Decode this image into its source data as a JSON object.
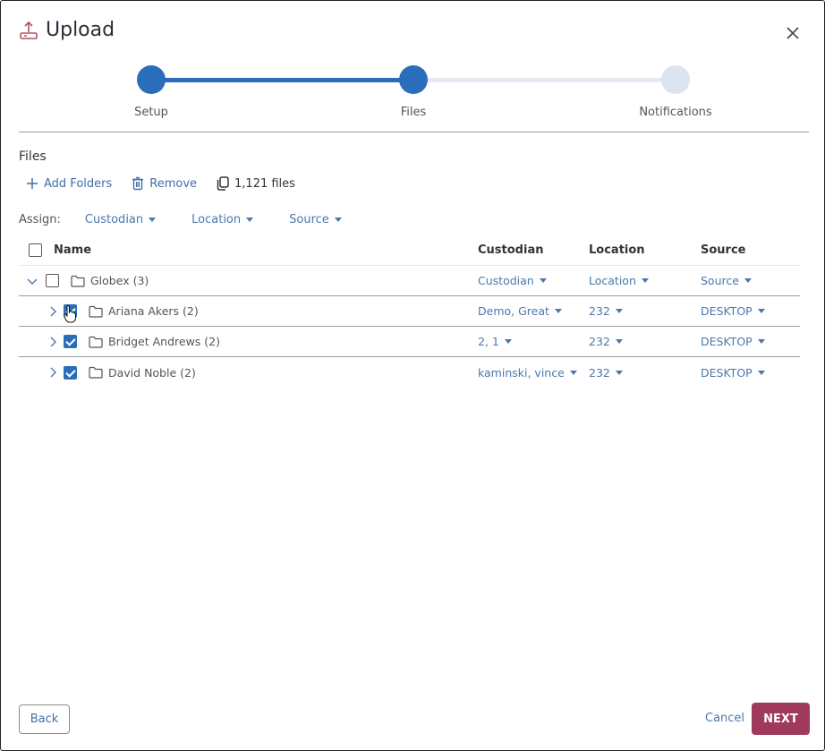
{
  "dialog": {
    "title": "Upload",
    "title_icon": "upload-icon",
    "close_icon": "close-icon"
  },
  "stepper": {
    "steps": [
      {
        "label": "Setup",
        "state": "complete"
      },
      {
        "label": "Files",
        "state": "current"
      },
      {
        "label": "Notifications",
        "state": "pending"
      }
    ]
  },
  "files": {
    "section_title": "Files",
    "toolbar": {
      "add_folders_label": "Add Folders",
      "remove_label": "Remove",
      "file_count": "1,121 files"
    },
    "assign": {
      "label": "Assign:",
      "custodian": "Custodian",
      "location": "Location",
      "source": "Source"
    },
    "table": {
      "headers": {
        "name": "Name",
        "custodian": "Custodian",
        "location": "Location",
        "source": "Source"
      },
      "rows": [
        {
          "name": "Globex (3)",
          "custodian": "Custodian",
          "location": "Location",
          "source": "Source",
          "checked": false,
          "expanded": true,
          "level": 0
        },
        {
          "name": "Ariana Akers (2)",
          "custodian": "Demo, Great",
          "location": "232",
          "source": "DESKTOP",
          "checked": true,
          "expanded": false,
          "level": 1
        },
        {
          "name": "Bridget Andrews (2)",
          "custodian": "2, 1",
          "location": "232",
          "source": "DESKTOP",
          "checked": true,
          "expanded": false,
          "level": 1
        },
        {
          "name": "David Noble (2)",
          "custodian": "kaminski, vince",
          "location": "232",
          "source": "DESKTOP",
          "checked": true,
          "expanded": false,
          "level": 1
        }
      ]
    }
  },
  "footer": {
    "back_label": "Back",
    "cancel_label": "Cancel",
    "next_label": "NEXT"
  },
  "colors": {
    "accent": "#2a6ebb",
    "link": "#4a78ad",
    "primary_button": "#a03a5a",
    "title_icon": "#b5505f"
  }
}
